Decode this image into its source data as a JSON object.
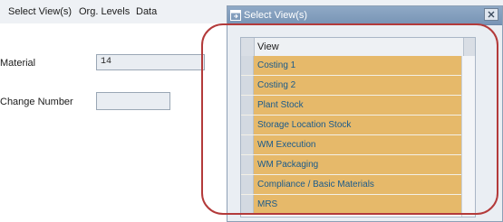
{
  "menu": {
    "items": [
      "Select View(s)",
      "Org. Levels",
      "Data"
    ]
  },
  "form": {
    "material_label": "Material",
    "material_value": "14",
    "change_number_label": "Change Number",
    "change_number_value": ""
  },
  "dialog": {
    "title": "Select View(s)",
    "column_header": "View",
    "views": [
      "Costing 1",
      "Costing 2",
      "Plant Stock",
      "Storage Location Stock",
      "WM Execution",
      "WM Packaging",
      "Compliance / Basic Materials",
      "MRS"
    ]
  },
  "colors": {
    "selected_row": "#e6b96a",
    "row_text": "#195a8c",
    "annotation": "#b33a3a"
  }
}
